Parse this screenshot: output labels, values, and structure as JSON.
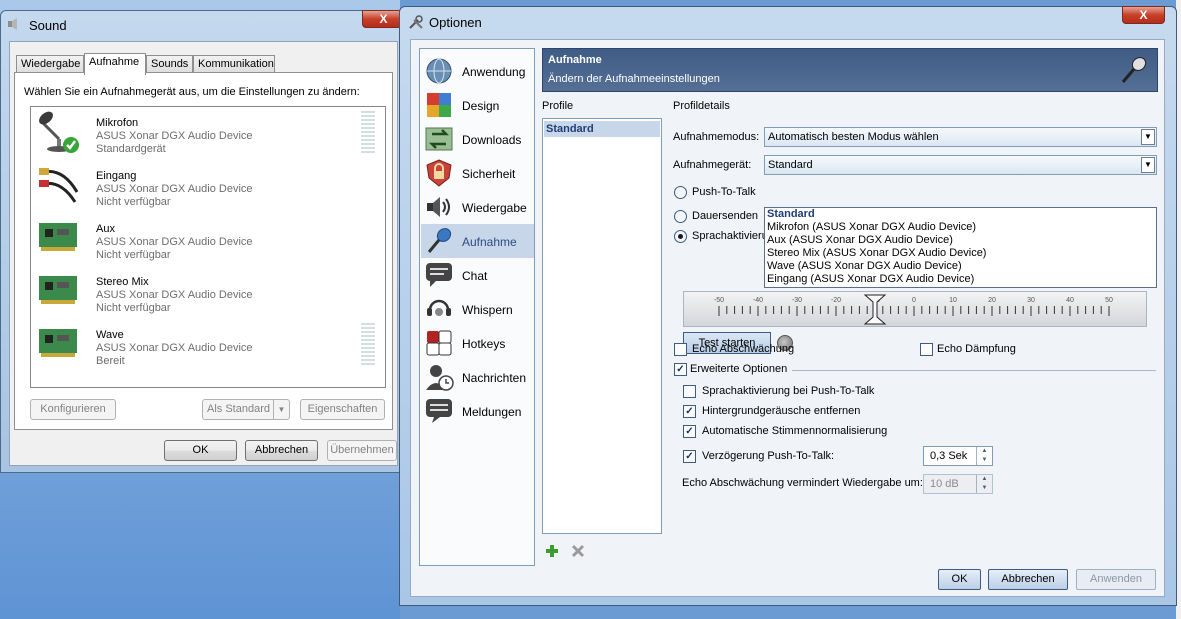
{
  "sound": {
    "title": "Sound",
    "close": "X",
    "tabs": [
      "Wiedergabe",
      "Aufnahme",
      "Sounds",
      "Kommunikation"
    ],
    "instruction": "Wählen Sie ein Aufnahmegerät aus, um die Einstellungen zu ändern:",
    "devices": [
      {
        "name": "Mikrofon",
        "device": "ASUS Xonar DGX Audio Device",
        "status": "Standardgerät",
        "icon": "microphone-icon"
      },
      {
        "name": "Eingang",
        "device": "ASUS Xonar DGX Audio Device",
        "status": "Nicht verfügbar",
        "icon": "rca-cable-icon"
      },
      {
        "name": "Aux",
        "device": "ASUS Xonar DGX Audio Device",
        "status": "Nicht verfügbar",
        "icon": "sound-card-icon"
      },
      {
        "name": "Stereo Mix",
        "device": "ASUS Xonar DGX Audio Device",
        "status": "Nicht verfügbar",
        "icon": "sound-card-icon"
      },
      {
        "name": "Wave",
        "device": "ASUS Xonar DGX Audio Device",
        "status": "Bereit",
        "icon": "sound-card-icon"
      }
    ],
    "buttons": {
      "configure": "Konfigurieren",
      "set_default": "Als Standard",
      "properties": "Eigenschaften",
      "ok": "OK",
      "cancel": "Abbrechen",
      "apply": "Übernehmen"
    }
  },
  "options": {
    "title": "Optionen",
    "close": "X",
    "nav": [
      {
        "label": "Anwendung",
        "icon": "globe-icon"
      },
      {
        "label": "Design",
        "icon": "color-palette-icon"
      },
      {
        "label": "Downloads",
        "icon": "download-arrows-icon"
      },
      {
        "label": "Sicherheit",
        "icon": "lock-shield-icon"
      },
      {
        "label": "Wiedergabe",
        "icon": "speaker-icon"
      },
      {
        "label": "Aufnahme",
        "icon": "microphone-icon"
      },
      {
        "label": "Chat",
        "icon": "chat-bubble-icon"
      },
      {
        "label": "Whispern",
        "icon": "headset-icon"
      },
      {
        "label": "Hotkeys",
        "icon": "keys-icon"
      },
      {
        "label": "Nachrichten",
        "icon": "user-clock-icon"
      },
      {
        "label": "Meldungen",
        "icon": "message-bubble-icon"
      }
    ],
    "header": {
      "title": "Aufnahme",
      "subtitle": "Ändern der Aufnahmeeinstellungen"
    },
    "profile_label": "Profile",
    "profiles": [
      "Standard"
    ],
    "details_label": "Profildetails",
    "mode_label": "Aufnahmemodus:",
    "mode_value": "Automatisch besten Modus wählen",
    "device_label": "Aufnahmegerät:",
    "device_value": "Standard",
    "device_options": [
      "Standard",
      "Mikrofon (ASUS Xonar DGX Audio Device)",
      "Aux (ASUS Xonar DGX Audio Device)",
      "Stereo Mix (ASUS Xonar DGX Audio Device)",
      "Wave (ASUS Xonar DGX Audio Device)",
      "Eingang (ASUS Xonar DGX Audio Device)"
    ],
    "radios": [
      "Push-To-Talk",
      "Dauersenden",
      "Sprachaktivierung"
    ],
    "radio_selected": 2,
    "slider_ticks": [
      "-50",
      "-40",
      "-30",
      "-20",
      "-10",
      "0",
      "10",
      "20",
      "30",
      "40",
      "50"
    ],
    "slider_value": -10,
    "test_button": "Test starten",
    "echo_reduction": "Echo Abschwächung",
    "echo_damping": "Echo Dämpfung",
    "advanced": "Erweiterte Optionen",
    "adv_options": [
      {
        "label": "Sprachaktivierung bei Push-To-Talk",
        "checked": false
      },
      {
        "label": "Hintergrundgeräusche entfernen",
        "checked": true
      },
      {
        "label": "Automatische Stimmennormalisierung",
        "checked": true
      },
      {
        "label": "Verzögerung Push-To-Talk:",
        "checked": true
      }
    ],
    "delay_value": "0,3 Sek",
    "echo_amount_label": "Echo Abschwächung vermindert Wiedergabe um:",
    "echo_amount_value": "10 dB",
    "buttons": {
      "ok": "OK",
      "cancel": "Abbrechen",
      "apply": "Anwenden"
    },
    "add_icon": "plus-icon",
    "remove_icon": "x-icon"
  },
  "colors": {
    "accent": "#3f5c85",
    "selection": "#c7d6e8",
    "desktop": "#6b9bd2"
  }
}
